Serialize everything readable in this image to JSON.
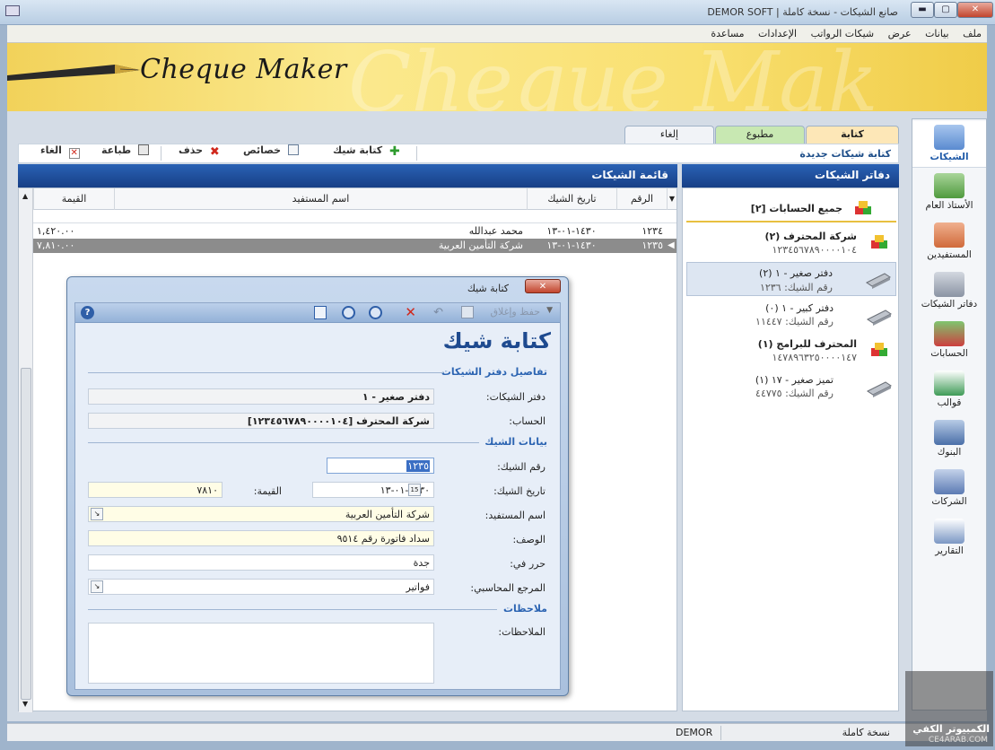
{
  "window": {
    "title": "صانع الشيكات - نسخة كاملة | DEMOR SOFT",
    "min": "▬",
    "max": "▢",
    "close": "✕"
  },
  "menu": [
    "ملف",
    "بيانات",
    "عرض",
    "شيكات الرواتب",
    "الإعدادات",
    "مساعدة"
  ],
  "banner": {
    "logo": "Cheque Maker",
    "ghost": "Cheque Mak"
  },
  "sidenav": [
    {
      "label": "الشيكات",
      "icon": "cheques-icon",
      "color": "#5a8bd0",
      "active": true
    },
    {
      "label": "الأستاذ العام",
      "icon": "ledger-icon",
      "color": "#4f9a3e"
    },
    {
      "label": "المستفيدين",
      "icon": "beneficiaries-icon",
      "color": "#d06a3a"
    },
    {
      "label": "دفاتر الشيكات",
      "icon": "chequebooks-icon",
      "color": "#8a93a3"
    },
    {
      "label": "الحسابات",
      "icon": "accounts-icon",
      "color": "#cc3f3f"
    },
    {
      "label": "قوالب",
      "icon": "templates-icon",
      "color": "#3f9b57"
    },
    {
      "label": "البنوك",
      "icon": "banks-icon",
      "color": "#4a6fa8"
    },
    {
      "label": "الشركات",
      "icon": "companies-icon",
      "color": "#5b7ab3"
    },
    {
      "label": "التقارير",
      "icon": "reports-icon",
      "color": "#7b97c4"
    }
  ],
  "tabs": [
    "كتابة",
    "مطبوع",
    "إلغاء"
  ],
  "subbar": {
    "new_label": "كتابة شيكات جديدة"
  },
  "toolbar": {
    "write": "كتابة شيك",
    "props": "خصائص",
    "delete": "حذف",
    "print": "طباعة",
    "cancel": "الغاء"
  },
  "left_panel": {
    "title": "قائمة الشيكات",
    "columns": [
      "الرقم",
      "تاريخ الشيك",
      "اسم المستفيد",
      "القيمة"
    ],
    "rows": [
      {
        "num": "١٢٣٤",
        "date": "١٤٣٠-٠١-١٣",
        "payee": "محمد عبدالله",
        "amount": "١,٤٢٠.٠٠",
        "selected": false
      },
      {
        "num": "١٢٣٥",
        "date": "١٤٣٠-٠١-١٣",
        "payee": "شركة التأمين العربية",
        "amount": "٧,٨١٠.٠٠",
        "selected": true
      }
    ]
  },
  "right_panel": {
    "title": "دفاتر الشيكات",
    "all_accounts": "جميع الحسابات [٢]",
    "accounts": [
      {
        "name": "شركة المحترف (٢)",
        "number": "١٢٣٤٥٦٧٨٩٠٠٠٠١٠٤",
        "books": [
          {
            "name": "دفتر صغير - ١ (٢)",
            "sub": "رقم الشيك: ١٢٣٦",
            "selected": true
          },
          {
            "name": "دفتر كبير - ١ (٠)",
            "sub": "رقم الشيك: ١١٤٤٧",
            "selected": false
          }
        ]
      },
      {
        "name": "المحترف للبرامج (١)",
        "number": "١٤٧٨٩٦٣٢٥٠٠٠٠١٤٧",
        "books": [
          {
            "name": "تميز صغير - ١٧ (١)",
            "sub": "رقم الشيك: ٤٤٧٧٥",
            "selected": false
          }
        ]
      }
    ]
  },
  "dialog": {
    "title": "كتابة شيك",
    "close": "✕",
    "save_close": "حفظ وإغلاق",
    "heading": "كتابة شيك",
    "sec_book": "تفاصيل دفتر الشيكات",
    "sec_cheque": "بيانات الشيك",
    "sec_notes": "ملاحظات",
    "labels": {
      "book": "دفتر الشيكات:",
      "account": "الحساب:",
      "cheque_no": "رقم الشيك:",
      "cheque_date": "تاريخ الشيك:",
      "amount": "القيمة:",
      "payee": "اسم المستفيد:",
      "desc": "الوصف:",
      "place": "حرر في:",
      "ref": "المرجع المحاسبي:",
      "notes": "الملاحظات:"
    },
    "values": {
      "book": "دفتر صغير - ١",
      "account": "شركة المحترف [١٢٣٤٥٦٧٨٩٠٠٠٠١٠٤]",
      "cheque_no": "١٢٣٥",
      "cheque_date": "١٤٣٠-٠١-١٣",
      "amount": "٧٨١٠",
      "payee": "شركة التأمين العربية",
      "desc": "سداد فاتورة رقم ٩٥١٤",
      "place": "جدة",
      "ref": "فواتير",
      "notes": ""
    },
    "calendar_glyph": "15"
  },
  "status": {
    "edition": "نسخة كاملة",
    "user": "DEMOR"
  },
  "watermark": {
    "line1": "الكمبيوتر الكفي",
    "line2": "CE4ARAB.COM"
  }
}
